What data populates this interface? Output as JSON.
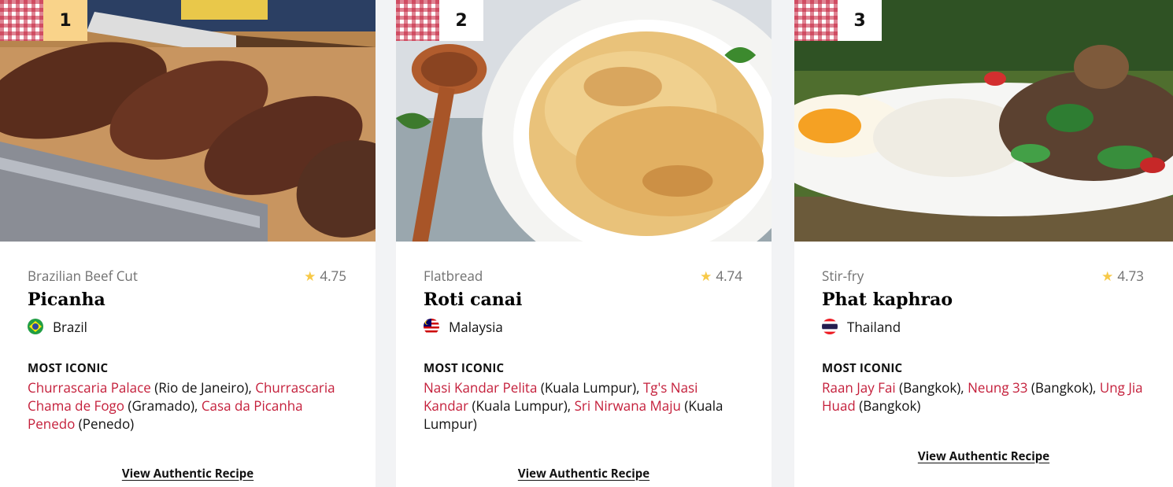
{
  "cards": [
    {
      "rank": "1",
      "category": "Brazilian Beef Cut",
      "rating": "4.75",
      "name": "Picanha",
      "country": "Brazil",
      "iconic_label": "MOST ICONIC",
      "places": [
        {
          "name": "Churrascaria Palace",
          "loc": " (Rio de Janeiro), "
        },
        {
          "name": "Churrascaria Chama de Fogo",
          "loc": " (Gramado), "
        },
        {
          "name": "Casa da Picanha Penedo",
          "loc": " (Penedo)"
        }
      ],
      "recipe_label": "View Authentic Recipe"
    },
    {
      "rank": "2",
      "category": "Flatbread",
      "rating": "4.74",
      "name": "Roti canai",
      "country": "Malaysia",
      "iconic_label": "MOST ICONIC",
      "places": [
        {
          "name": "Nasi Kandar Pelita",
          "loc": " (Kuala Lumpur), "
        },
        {
          "name": "Tg's Nasi Kandar",
          "loc": " (Kuala Lumpur), "
        },
        {
          "name": "Sri Nirwana Maju",
          "loc": " (Kuala Lumpur)"
        }
      ],
      "recipe_label": "View Authentic Recipe"
    },
    {
      "rank": "3",
      "category": "Stir-fry",
      "rating": "4.73",
      "name": "Phat kaphrao",
      "country": "Thailand",
      "iconic_label": "MOST ICONIC",
      "places": [
        {
          "name": "Raan Jay Fai",
          "loc": " (Bangkok), "
        },
        {
          "name": "Neung 33",
          "loc": " (Bangkok), "
        },
        {
          "name": "Ung Jia Huad",
          "loc": " (Bangkok)"
        }
      ],
      "recipe_label": "View Authentic Recipe"
    }
  ],
  "icons": {
    "rating": "star-icon",
    "flags": [
      "brazil-flag-icon",
      "malaysia-flag-icon",
      "thailand-flag-icon"
    ]
  },
  "colors": {
    "link": "#c41e3a",
    "rank_highlight": "#f9d38a",
    "star": "#f7c948",
    "muted_text": "#707070"
  }
}
